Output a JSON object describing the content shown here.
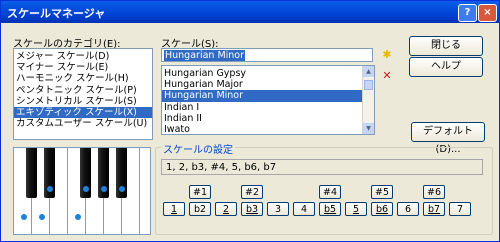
{
  "window": {
    "title": "スケールマネージャ",
    "help_glyph": "?",
    "close_glyph": "×"
  },
  "categories": {
    "label": "スケールのカテゴリ(E):",
    "items": [
      "メジャー スケール(D)",
      "マイナー スケール(E)",
      "ハーモニック スケール(H)",
      "ペンタトニック スケール(P)",
      "シンメトリカル スケール(S)",
      "エキゾティック スケール(X)",
      "カスタムユーザー スケール(U)"
    ],
    "selected_index": 5
  },
  "scales": {
    "label": "スケール(S):",
    "current_value": "Hungarian Minor",
    "items": [
      "Hungarian Gypsy",
      "Hungarian Major",
      "Hungarian Minor",
      "Indian I",
      "Indian II",
      "Iwato",
      "Japanese"
    ],
    "selected_index": 2
  },
  "buttons": {
    "close": "閉じる",
    "help": "ヘルプ",
    "default": "デフォルト(D)..."
  },
  "icons": {
    "new_scale": "star-icon",
    "delete_scale": "delete-x-icon"
  },
  "colors": {
    "accent": "#316ac5",
    "title_bar": "#0054e3",
    "degree_dot": "#1e82d8",
    "delete": "#c0201e",
    "new": "#e6b800"
  },
  "scale_settings": {
    "title": "スケールの設定",
    "formula": "1, 2, b3, #4, 5, b6, b7",
    "sharp_buttons": [
      "#1",
      "#2",
      "#4",
      "#5",
      "#6"
    ],
    "degree_buttons": [
      "1",
      "b2",
      "2",
      "b3",
      "3",
      "4",
      "b5",
      "5",
      "b6",
      "6",
      "b7",
      "7"
    ],
    "active_degrees": [
      "1",
      "2",
      "b3",
      "b5",
      "5",
      "b6",
      "b7"
    ]
  }
}
